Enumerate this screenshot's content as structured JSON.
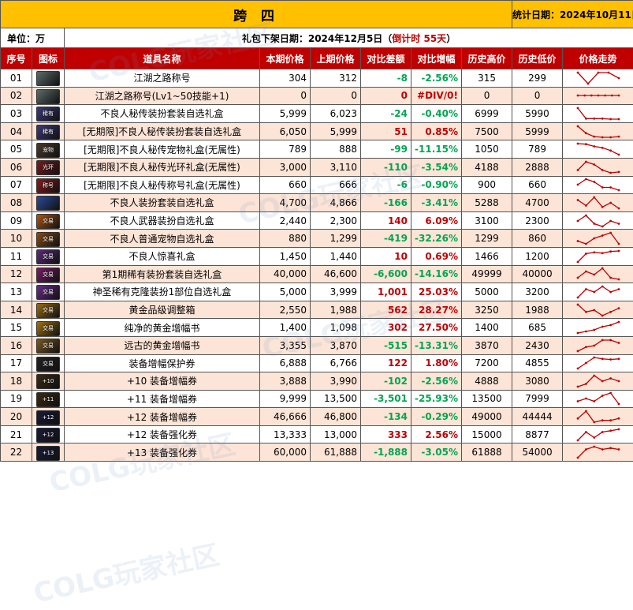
{
  "title": "跨 四",
  "stat_date": "统计日期：2024年10月11日",
  "unit": "单位：万",
  "offshelf": {
    "prefix": "礼包下架日期：2024年12月5日（",
    "countdown": "倒计时 55天",
    "suffix": "）"
  },
  "headers": [
    "序号",
    "图标",
    "道具名称",
    "本期价格",
    "上期价格",
    "对比差额",
    "对比增幅",
    "历史高价",
    "历史低价",
    "价格走势"
  ],
  "watermark": "COLG玩家社区",
  "colors": {
    "title_bg": "#FFC000",
    "header_bg": "#C00000",
    "stripe": "#FCE4D6",
    "up": "#C00000",
    "down": "#00A651"
  },
  "rows": [
    {
      "no": "01",
      "icon": {
        "name": "scroll-medal-icon",
        "label": "",
        "bg": "#5b6b6a"
      },
      "name": "江湖之路称号",
      "cur": "304",
      "prev": "312",
      "diff": "-8",
      "pct": "-2.56%",
      "high": "315",
      "low": "299",
      "trend": [
        3,
        1,
        3,
        3,
        2
      ]
    },
    {
      "no": "02",
      "icon": {
        "name": "scroll-medal-icon",
        "label": "",
        "bg": "#5b6b6a"
      },
      "name": "江湖之路称号(Lv1~50技能+1)",
      "cur": "0",
      "prev": "0",
      "diff": "0",
      "pct": "#DIV/0!",
      "high": "0",
      "low": "0",
      "trend": [
        2,
        2,
        2,
        2,
        2,
        2,
        2
      ]
    },
    {
      "no": "03",
      "icon": {
        "name": "outfit-box-icon",
        "label": "稀有",
        "bg": "#3b3a7a"
      },
      "name": "不良人秘传装扮套装自选礼盒",
      "cur": "5,999",
      "prev": "6,023",
      "diff": "-24",
      "pct": "-0.40%",
      "high": "6999",
      "low": "5990",
      "trend": [
        6,
        2,
        2,
        2,
        1.8,
        1.8
      ]
    },
    {
      "no": "04",
      "icon": {
        "name": "outfit-box-icon",
        "label": "稀有",
        "bg": "#3b3a7a"
      },
      "name": "[无期限]不良人秘传装扮套装自选礼盒",
      "cur": "6,050",
      "prev": "5,999",
      "diff": "51",
      "pct": "0.85%",
      "high": "7500",
      "low": "5999",
      "trend": [
        5,
        3,
        2,
        1.8,
        1.8,
        2
      ]
    },
    {
      "no": "05",
      "icon": {
        "name": "pet-box-icon",
        "label": "宠物",
        "bg": "#4a3a2a"
      },
      "name": "[无期限]不良人秘传宠物礼盒(无属性)",
      "cur": "789",
      "prev": "888",
      "diff": "-99",
      "pct": "-11.15%",
      "high": "1050",
      "low": "789",
      "trend": [
        5,
        4.8,
        4,
        3.5,
        2.5,
        1
      ]
    },
    {
      "no": "06",
      "icon": {
        "name": "aura-box-icon",
        "label": "光环",
        "bg": "#7a1a1a"
      },
      "name": "[无期限]不良人秘传光环礼盒(无属性)",
      "cur": "3,000",
      "prev": "3,110",
      "diff": "-110",
      "pct": "-3.54%",
      "high": "4188",
      "low": "2888",
      "trend": [
        2,
        5,
        4,
        2,
        1,
        1.3
      ]
    },
    {
      "no": "07",
      "icon": {
        "name": "title-box-icon",
        "label": "称号",
        "bg": "#8a1a1a"
      },
      "name": "[无期限]不良人秘传称号礼盒(无属性)",
      "cur": "660",
      "prev": "666",
      "diff": "-6",
      "pct": "-0.90%",
      "high": "900",
      "low": "660",
      "trend": [
        3,
        5,
        4,
        2,
        2,
        1
      ]
    },
    {
      "no": "08",
      "icon": {
        "name": "outfit-box-icon",
        "label": "",
        "bg": "#2a4a9a"
      },
      "name": "不良人装扮套装自选礼盒",
      "cur": "4,700",
      "prev": "4,866",
      "diff": "-166",
      "pct": "-3.41%",
      "high": "5288",
      "low": "4700",
      "trend": [
        4,
        2,
        5,
        1.5,
        3,
        1
      ]
    },
    {
      "no": "09",
      "icon": {
        "name": "weapon-outfit-box-icon",
        "label": "交易",
        "bg": "#b0540f"
      },
      "name": "不良人武器装扮自选礼盒",
      "cur": "2,440",
      "prev": "2,300",
      "diff": "140",
      "pct": "6.09%",
      "high": "3100",
      "low": "2300",
      "trend": [
        3,
        5,
        2,
        1,
        3,
        2
      ]
    },
    {
      "no": "10",
      "icon": {
        "name": "pet-box-icon",
        "label": "交易",
        "bg": "#8a4a10"
      },
      "name": "不良人普通宠物自选礼盒",
      "cur": "880",
      "prev": "1,299",
      "diff": "-419",
      "pct": "-32.26%",
      "high": "1299",
      "low": "860",
      "trend": [
        2,
        1,
        3,
        4,
        5,
        1
      ]
    },
    {
      "no": "11",
      "icon": {
        "name": "surprise-box-icon",
        "label": "交易",
        "bg": "#5a2a7a"
      },
      "name": "不良人惊喜礼盒",
      "cur": "1,450",
      "prev": "1,440",
      "diff": "10",
      "pct": "0.69%",
      "high": "1466",
      "low": "1200",
      "trend": [
        1,
        4,
        4.5,
        4.2,
        4.8,
        5
      ]
    },
    {
      "no": "12",
      "icon": {
        "name": "rare-outfit-box-icon",
        "label": "交易",
        "bg": "#7a1a6a"
      },
      "name": "第1期稀有装扮套装自选礼盒",
      "cur": "40,000",
      "prev": "46,600",
      "diff": "-6,600",
      "pct": "-14.16%",
      "high": "49999",
      "low": "40000",
      "trend": [
        2,
        4,
        3,
        5,
        2,
        1.5
      ]
    },
    {
      "no": "13",
      "icon": {
        "name": "clone-outfit-box-icon",
        "label": "交易",
        "bg": "#6a2a8a"
      },
      "name": "神圣稀有克隆装扮1部位自选礼盒",
      "cur": "5,000",
      "prev": "3,999",
      "diff": "1,001",
      "pct": "25.03%",
      "high": "5000",
      "low": "3200",
      "trend": [
        1,
        4,
        3,
        5,
        3,
        4
      ]
    },
    {
      "no": "14",
      "icon": {
        "name": "golden-box-icon",
        "label": "交易",
        "bg": "#9a6a10"
      },
      "name": "黄金品级调整箱",
      "cur": "2,550",
      "prev": "1,988",
      "diff": "562",
      "pct": "28.27%",
      "high": "3250",
      "low": "1988",
      "trend": [
        4,
        2,
        2.5,
        1,
        2,
        3
      ]
    },
    {
      "no": "15",
      "icon": {
        "name": "golden-amplify-book-icon",
        "label": "交易",
        "bg": "#a07010"
      },
      "name": "纯净的黄金增幅书",
      "cur": "1,400",
      "prev": "1,098",
      "diff": "302",
      "pct": "27.50%",
      "high": "1400",
      "low": "685",
      "trend": [
        1,
        1.5,
        2,
        3,
        3.5,
        4.5
      ]
    },
    {
      "no": "16",
      "icon": {
        "name": "ancient-amplify-book-icon",
        "label": "交易",
        "bg": "#7a5a20"
      },
      "name": "远古的黄金增幅书",
      "cur": "3,355",
      "prev": "3,870",
      "diff": "-515",
      "pct": "-13.31%",
      "high": "3870",
      "low": "2430",
      "trend": [
        1,
        2.5,
        3,
        5,
        5,
        4
      ]
    },
    {
      "no": "17",
      "icon": {
        "name": "protection-ticket-icon",
        "label": "交易",
        "bg": "#222222"
      },
      "name": "装备增幅保护券",
      "cur": "6,888",
      "prev": "6,766",
      "diff": "122",
      "pct": "1.80%",
      "high": "7200",
      "low": "4855",
      "trend": [
        1,
        3,
        5,
        4.5,
        4.3,
        4.5
      ]
    },
    {
      "no": "18",
      "icon": {
        "name": "amplify-ticket-10-icon",
        "label": "+10",
        "bg": "#3a2a10"
      },
      "name": "+10 装备增幅券",
      "cur": "3,888",
      "prev": "3,990",
      "diff": "-102",
      "pct": "-2.56%",
      "high": "4888",
      "low": "3080",
      "trend": [
        1,
        2,
        5,
        3,
        4,
        3
      ]
    },
    {
      "no": "19",
      "icon": {
        "name": "amplify-ticket-11-icon",
        "label": "+11",
        "bg": "#3a2a10"
      },
      "name": "+11 装备增幅券",
      "cur": "9,999",
      "prev": "13,500",
      "diff": "-3,501",
      "pct": "-25.93%",
      "high": "13500",
      "low": "7999",
      "trend": [
        2,
        3,
        2,
        4,
        5,
        1
      ]
    },
    {
      "no": "20",
      "icon": {
        "name": "amplify-ticket-12-icon",
        "label": "+12",
        "bg": "#1a1a3a"
      },
      "name": "+12 装备增幅券",
      "cur": "46,666",
      "prev": "46,800",
      "diff": "-134",
      "pct": "-0.29%",
      "high": "49000",
      "low": "44444",
      "trend": [
        3,
        5,
        2,
        2.5,
        2.5,
        3
      ]
    },
    {
      "no": "21",
      "icon": {
        "name": "enhance-ticket-12-icon",
        "label": "+12",
        "bg": "#1a1a3a"
      },
      "name": "+12 装备强化券",
      "cur": "13,333",
      "prev": "13,000",
      "diff": "333",
      "pct": "2.56%",
      "high": "15000",
      "low": "8877",
      "trend": [
        1,
        4,
        2,
        4,
        4.5,
        5
      ]
    },
    {
      "no": "22",
      "icon": {
        "name": "enhance-ticket-13-icon",
        "label": "+13",
        "bg": "#1a1a3a"
      },
      "name": "+13 装备强化券",
      "cur": "60,000",
      "prev": "61,888",
      "diff": "-1,888",
      "pct": "-3.05%",
      "high": "61888",
      "low": "54000",
      "trend": [
        1,
        4,
        5,
        4,
        4.5,
        4
      ]
    }
  ]
}
